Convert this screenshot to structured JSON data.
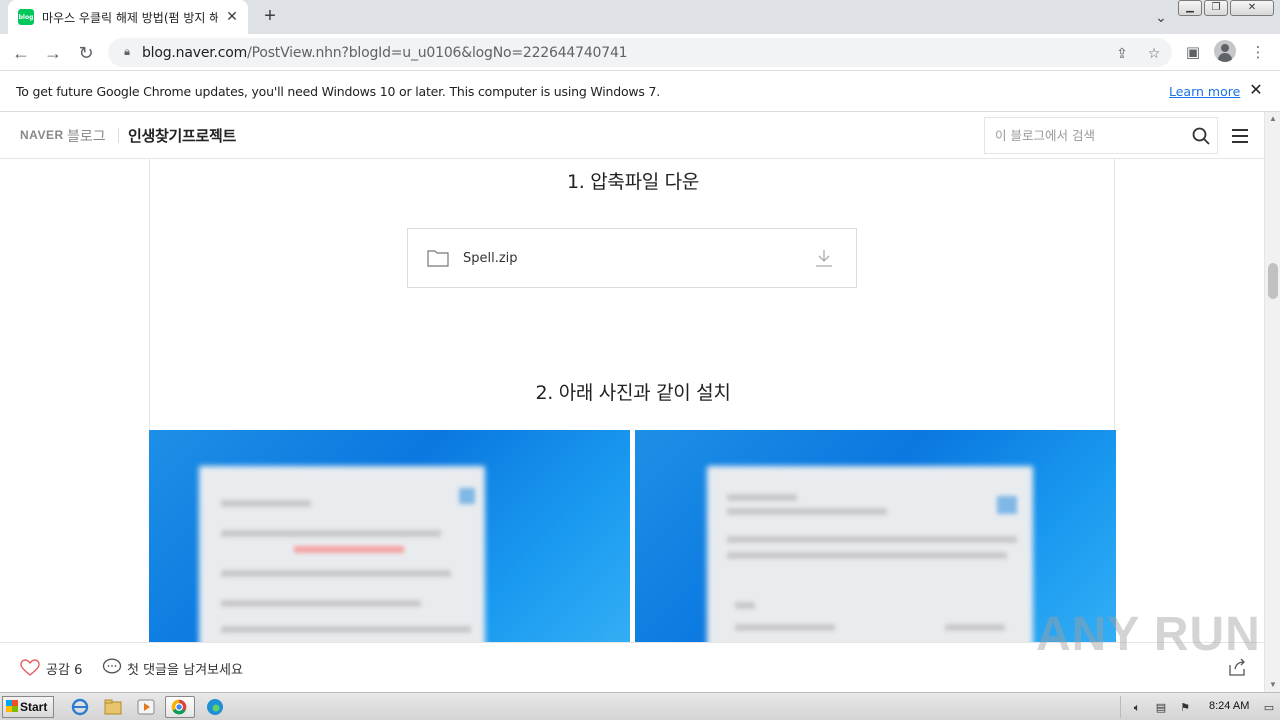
{
  "browser": {
    "tab_title": "마우스 우클릭 해제 방법(펌 방지 해",
    "favicon_text": "blog",
    "url_host": "blog.naver.com",
    "url_path": "/PostView.nhn?blogId=u_u0106&logNo=222644740741",
    "info_message": "To get future Google Chrome updates, you'll need Windows 10 or later. This computer is using Windows 7.",
    "learn_more": "Learn more"
  },
  "blog": {
    "naver": "NAVER",
    "blog_word": "블로그",
    "blog_name": "인생찾기프로젝트",
    "search_placeholder": "이 블로그에서 검색"
  },
  "post": {
    "step1": "1. 압축파일 다운",
    "file_name": "Spell.zip",
    "step2": "2. 아래 사진과 같이 설치"
  },
  "bottom": {
    "like_label": "공감",
    "like_count": "6",
    "comment_label": "첫 댓글을 남겨보세요"
  },
  "watermark": "ANY RUN",
  "taskbar": {
    "start_label": "Start",
    "clock": "8:24 AM"
  }
}
